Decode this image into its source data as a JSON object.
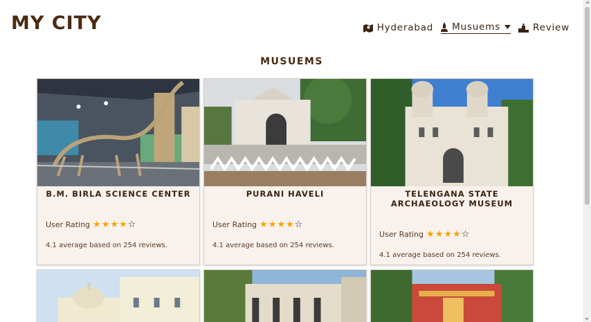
{
  "site": {
    "title": "MY CITY"
  },
  "nav": {
    "items": [
      {
        "label": "Hyderabad",
        "icon": "map-icon",
        "active": false
      },
      {
        "label": "Musuems",
        "icon": "monument-icon",
        "active": true
      },
      {
        "label": "Review",
        "icon": "podium-icon",
        "active": false
      }
    ]
  },
  "section": {
    "title": "MUSUEMS"
  },
  "cards": [
    {
      "title": "B.M. BIRLA SCIENCE CENTER",
      "rating_label": "User Rating",
      "rating": 4,
      "max_rating": 5,
      "summary": "4.1 average based on 254 reviews."
    },
    {
      "title": "PURANI HAVELI",
      "rating_label": "User Rating",
      "rating": 4,
      "max_rating": 5,
      "summary": "4.1 average based on 254 reviews."
    },
    {
      "title": "TELENGANA STATE ARCHAEOLOGY MUSEUM",
      "rating_label": "User Rating",
      "rating": 4,
      "max_rating": 5,
      "summary": "4.1 average based on 254 reviews."
    }
  ],
  "colors": {
    "brand": "#4a2a10",
    "card_bg": "#f9f1ec",
    "star": "#f5a300"
  }
}
